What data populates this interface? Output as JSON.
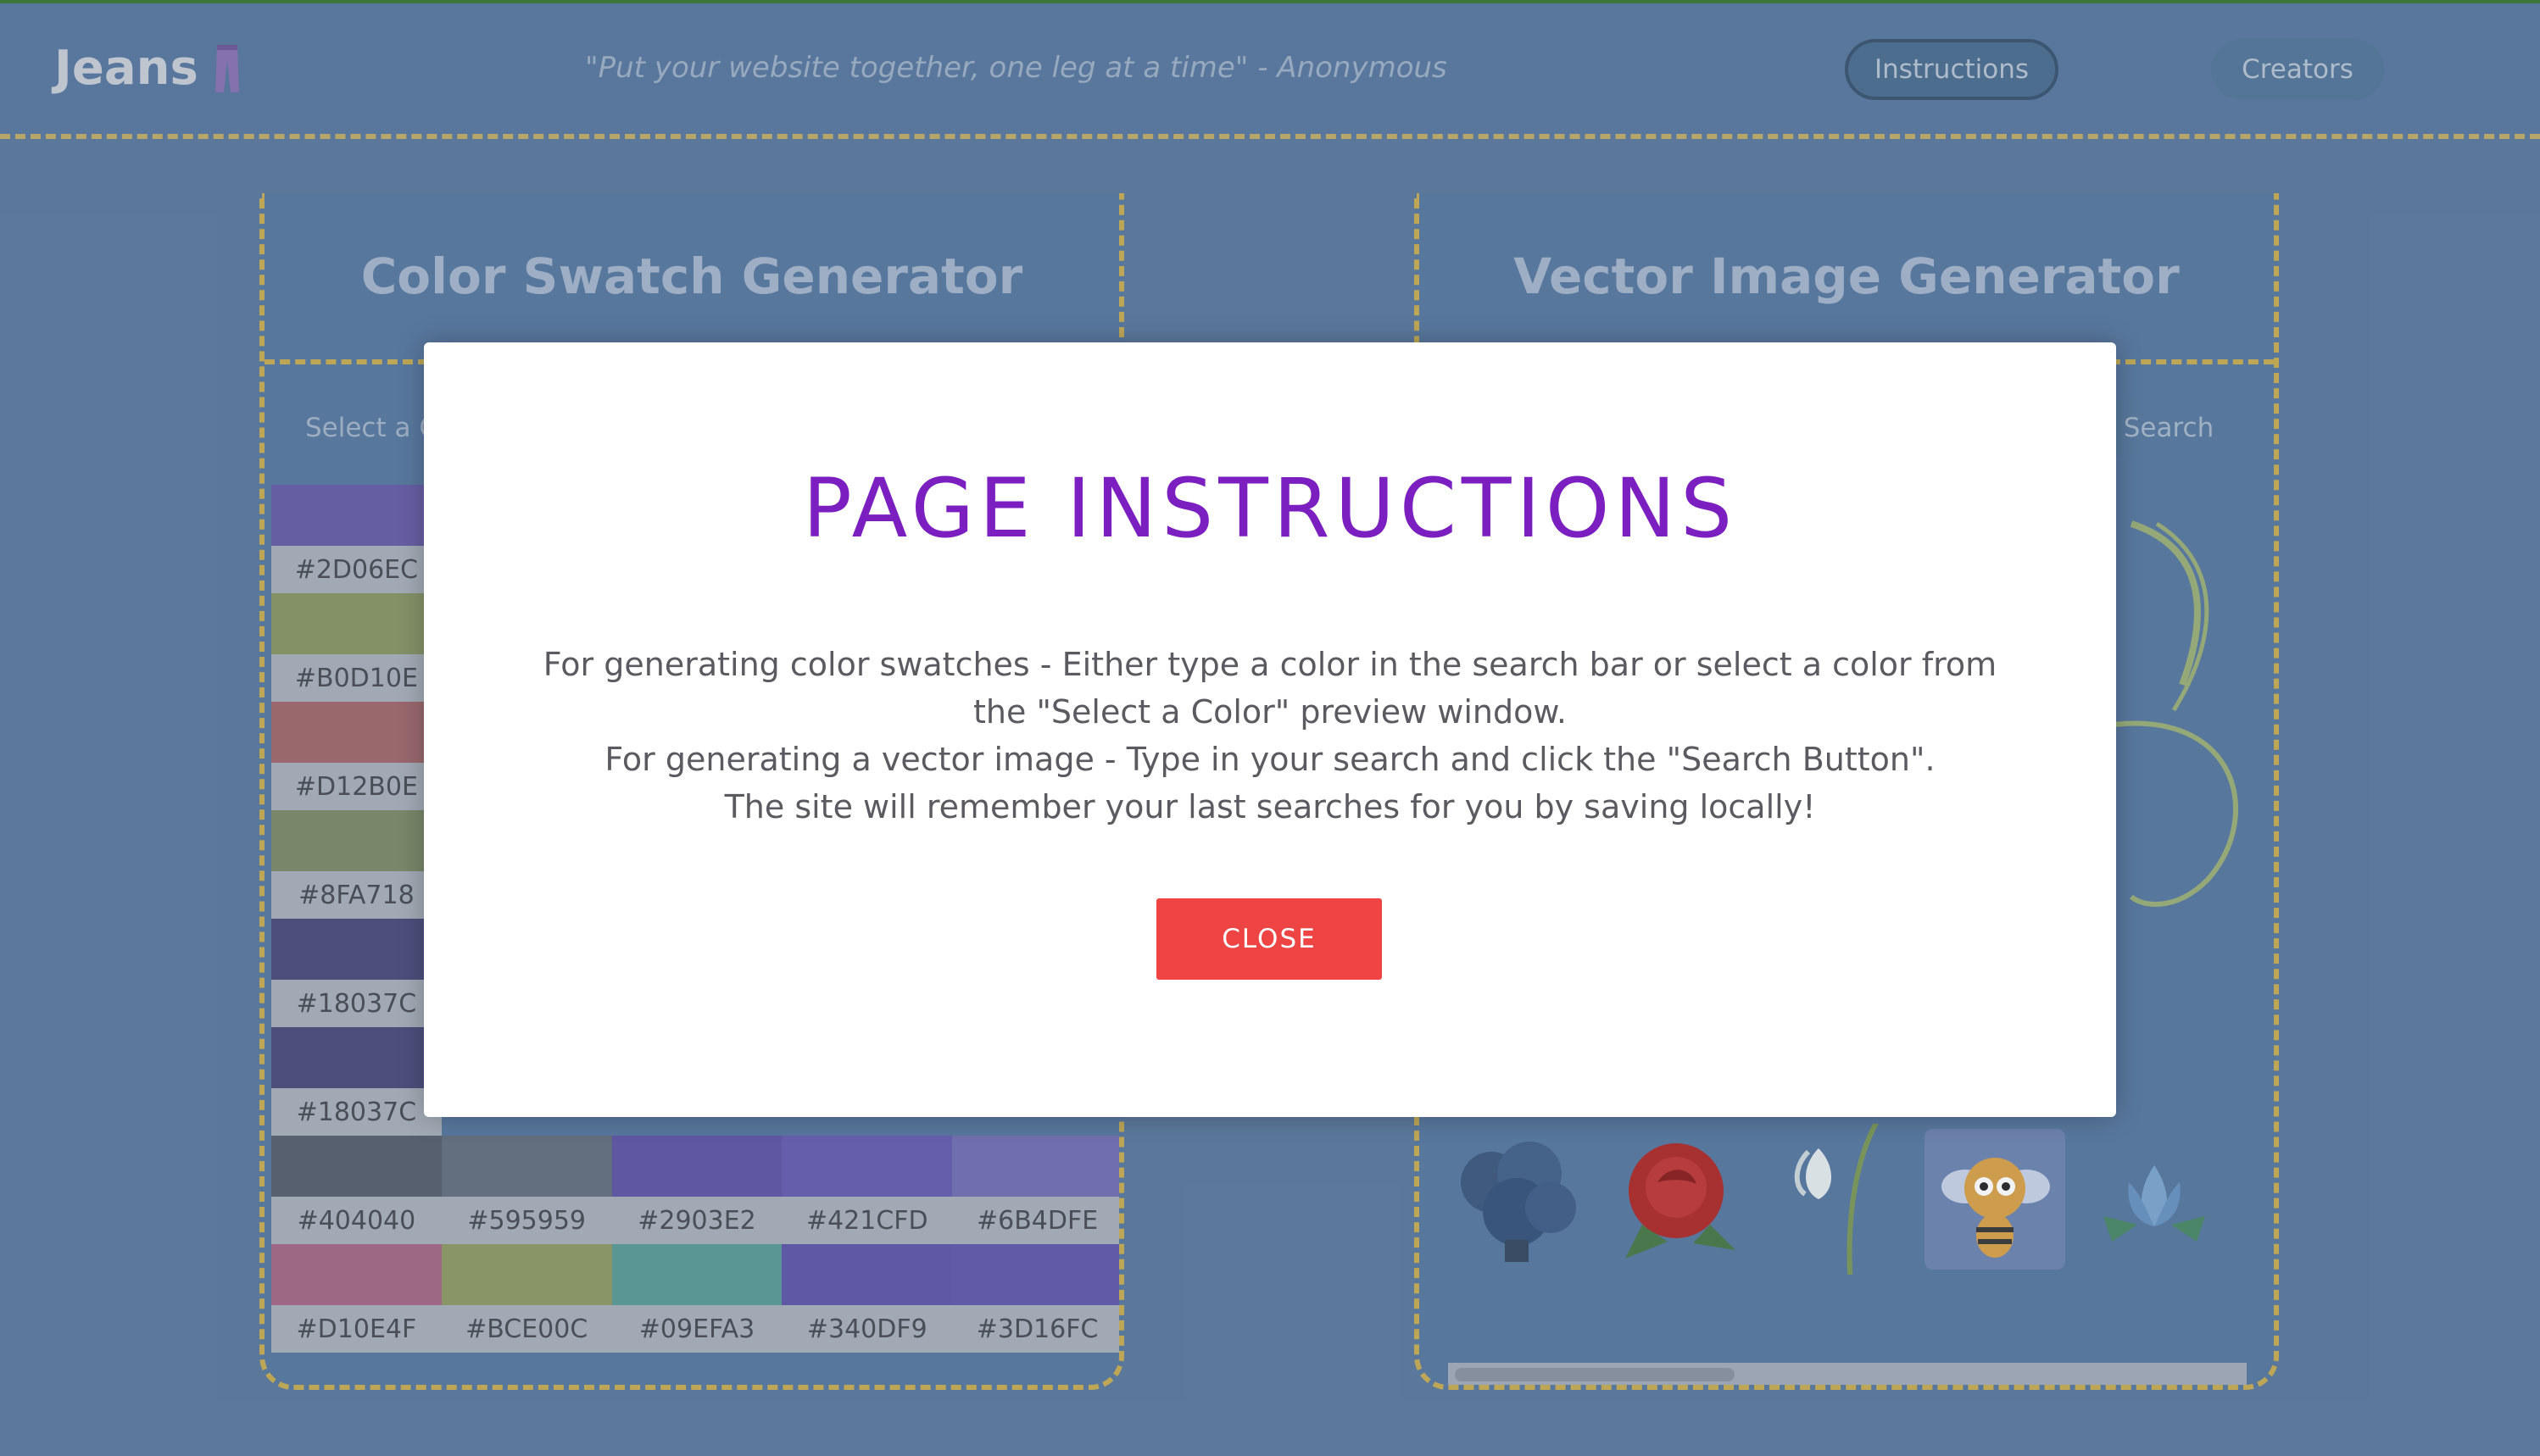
{
  "header": {
    "logo_text": "Jeans",
    "quote": "\"Put your website together, one leg at a time\" - Anonymous",
    "nav": {
      "instructions": "Instructions",
      "creators": "Creators"
    }
  },
  "color_panel": {
    "title": "Color Swatch Generator",
    "select_placeholder": "Select a C",
    "swatches": [
      [
        {
          "hex": "#2D06EC",
          "color": "#6a5fa8"
        },
        {
          "hex": "",
          "color": "#5f6d86"
        },
        {
          "hex": "",
          "color": "#5f6d86"
        },
        {
          "hex": "",
          "color": "#5f6d86"
        },
        {
          "hex": "",
          "color": "#5f6d86"
        }
      ],
      [
        {
          "hex": "#B0D10E",
          "color": "#8a9668"
        },
        {
          "hex": "",
          "color": "#5f6d86"
        },
        {
          "hex": "",
          "color": "#5f6d86"
        },
        {
          "hex": "",
          "color": "#5f6d86"
        },
        {
          "hex": "",
          "color": "#5f6d86"
        }
      ],
      [
        {
          "hex": "#D12B0E",
          "color": "#a06a6e"
        },
        {
          "hex": "",
          "color": "#5f6d86"
        },
        {
          "hex": "",
          "color": "#5f6d86"
        },
        {
          "hex": "",
          "color": "#5f6d86"
        },
        {
          "hex": "",
          "color": "#5f6d86"
        }
      ],
      [
        {
          "hex": "#8FA718",
          "color": "#7e8a6a"
        },
        {
          "hex": "",
          "color": "#5f6d86"
        },
        {
          "hex": "",
          "color": "#5f6d86"
        },
        {
          "hex": "",
          "color": "#5f6d86"
        },
        {
          "hex": "",
          "color": "#5f6d86"
        }
      ],
      [
        {
          "hex": "#18037C",
          "color": "#4e4f7e"
        },
        {
          "hex": "",
          "color": "#5f6d86"
        },
        {
          "hex": "",
          "color": "#5f6d86"
        },
        {
          "hex": "",
          "color": "#5f6d86"
        },
        {
          "hex": "",
          "color": "#5f6d86"
        }
      ],
      [
        {
          "hex": "#18037C",
          "color": "#4e4f7e"
        },
        {
          "hex": "",
          "color": "#5f6d86"
        },
        {
          "hex": "",
          "color": "#5f6d86"
        },
        {
          "hex": "",
          "color": "#5f6d86"
        },
        {
          "hex": "",
          "color": "#5f6d86"
        }
      ],
      [
        {
          "hex": "#404040",
          "color": "#5a6170"
        },
        {
          "hex": "#595959",
          "color": "#667080"
        },
        {
          "hex": "#2903E2",
          "color": "#6257a8"
        },
        {
          "hex": "#421CFD",
          "color": "#695fb0"
        },
        {
          "hex": "#6B4DFE",
          "color": "#7670b3"
        }
      ],
      [
        {
          "hex": "#D10E4F",
          "color": "#a56a86"
        },
        {
          "hex": "#BCE00C",
          "color": "#909a68"
        },
        {
          "hex": "#09EFA3",
          "color": "#5d9c98"
        },
        {
          "hex": "#340DF9",
          "color": "#6259ab"
        },
        {
          "hex": "#3D16FC",
          "color": "#645bad"
        }
      ]
    ]
  },
  "vector_panel": {
    "title": "Vector Image Generator",
    "search_label": "Search",
    "thumbnails": [
      "blue-flower-bush-icon",
      "red-rose-icon",
      "snowdrop-flower-icon",
      "cartoon-bee-icon",
      "blue-lotus-icon",
      "partial-thumbnail-icon"
    ]
  },
  "modal": {
    "title": "PAGE INSTRUCTIONS",
    "line1": "For generating color swatches - Either type a color in the search bar or select a color from the \"Select a Color\" preview window.",
    "line2": "For generating a vector image - Type in your search and click the \"Search Button\".",
    "line3": "The site will remember your last searches for you by saving locally!",
    "close_label": "CLOSE"
  },
  "colors": {
    "accent_title": "#7b1fc0",
    "close_button": "#ef4444",
    "dashed_border": "#c8ad55"
  }
}
